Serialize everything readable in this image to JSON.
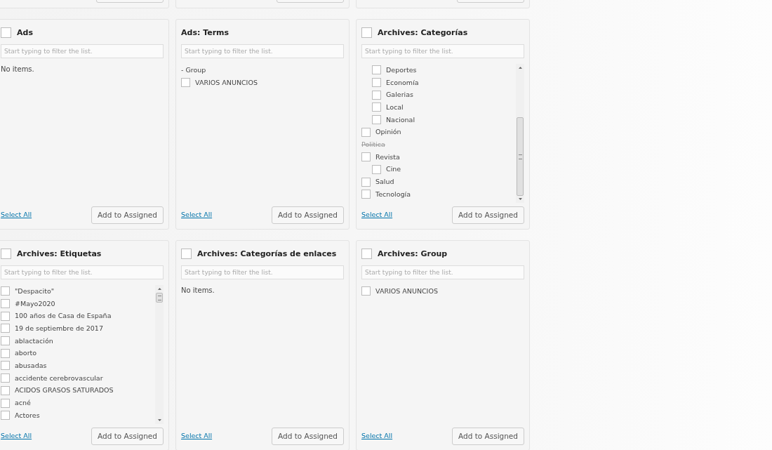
{
  "panels": [
    {
      "title": "Ads",
      "checked": false,
      "placeholder": "Start typing to filter the list.",
      "empty_text": "No items.",
      "select_all": "Select All",
      "button": "Add to Assigned"
    },
    {
      "title": "Ads: Terms",
      "placeholder": "Start typing to filter the list.",
      "items": [
        {
          "kind": "heading",
          "label": "- Group"
        },
        {
          "kind": "checkbox",
          "label": "VARIOS ANUNCIOS",
          "checked": false
        }
      ],
      "select_all": "Select All",
      "button": "Add to Assigned"
    },
    {
      "title": "Archives: Categorías",
      "checked": false,
      "placeholder": "Start typing to filter the list.",
      "items": [
        {
          "kind": "offscreen",
          "children": [
            {
              "kind": "checkbox",
              "label": "Deportes",
              "checked": false
            },
            {
              "kind": "checkbox",
              "label": "Economía",
              "checked": false
            },
            {
              "kind": "checkbox",
              "label": "Galerias",
              "checked": false
            },
            {
              "kind": "checkbox",
              "label": "Local",
              "checked": false
            },
            {
              "kind": "checkbox",
              "label": "Nacional",
              "checked": false
            }
          ]
        },
        {
          "kind": "checkbox",
          "label": "Opinión",
          "checked": false
        },
        {
          "kind": "struck",
          "label": "Politica"
        },
        {
          "kind": "checkbox",
          "label": "Revista",
          "checked": false,
          "children": [
            {
              "kind": "checkbox",
              "label": "Cine",
              "checked": false
            }
          ]
        },
        {
          "kind": "checkbox",
          "label": "Salud",
          "checked": false
        },
        {
          "kind": "checkbox",
          "label": "Tecnología",
          "checked": false
        }
      ],
      "scrollable": true,
      "select_all": "Select All",
      "button": "Add to Assigned"
    },
    {
      "title": "Archives: Etiquetas",
      "checked": false,
      "placeholder": "Start typing to filter the list.",
      "items": [
        {
          "kind": "checkbox",
          "label": "\"Despacito\"",
          "checked": false
        },
        {
          "kind": "checkbox",
          "label": "#Mayo2020",
          "checked": false
        },
        {
          "kind": "checkbox",
          "label": "100 años de Casa de España",
          "checked": false
        },
        {
          "kind": "checkbox",
          "label": "19 de septiembre de 2017",
          "checked": false
        },
        {
          "kind": "checkbox",
          "label": "ablactación",
          "checked": false
        },
        {
          "kind": "checkbox",
          "label": "aborto",
          "checked": false
        },
        {
          "kind": "checkbox",
          "label": "abusadas",
          "checked": false
        },
        {
          "kind": "checkbox",
          "label": "accidente cerebrovascular",
          "checked": false
        },
        {
          "kind": "checkbox",
          "label": "ACIDOS GRASOS SATURADOS",
          "checked": false
        },
        {
          "kind": "checkbox",
          "label": "acné",
          "checked": false
        },
        {
          "kind": "checkbox",
          "label": "Actores",
          "checked": false
        }
      ],
      "scrollable": true,
      "select_all": "Select All",
      "button": "Add to Assigned"
    },
    {
      "title": "Archives: Categorías de enlaces",
      "checked": false,
      "placeholder": "Start typing to filter the list.",
      "empty_text": "No items.",
      "select_all": "Select All",
      "button": "Add to Assigned"
    },
    {
      "title": "Archives: Group",
      "checked": false,
      "placeholder": "Start typing to filter the list.",
      "items": [
        {
          "kind": "checkbox",
          "label": "VARIOS ANUNCIOS",
          "checked": false
        }
      ],
      "select_all": "Select All",
      "button": "Add to Assigned"
    }
  ]
}
